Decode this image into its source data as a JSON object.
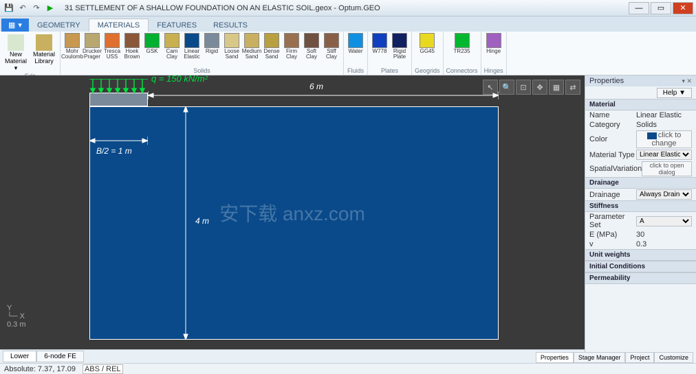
{
  "app": {
    "title": "31 SETTLEMENT OF A SHALLOW FOUNDATION ON AN ELASTIC SOIL.geox - Optum.GEO"
  },
  "tabs": {
    "file": "",
    "geometry": "GEOMETRY",
    "materials": "MATERIALS",
    "features": "FEATURES",
    "results": "RESULTS"
  },
  "ribbon": {
    "edit_group": "Edit",
    "new_material": "New\nMaterial ▾",
    "material_library": "Material\nLibrary",
    "solids_group": "Solids",
    "fluids_group": "Fluids",
    "plates_group": "Plates",
    "geogrids_group": "Geogrids",
    "connectors_group": "Connectors",
    "hinges_group": "Hinges",
    "materials": [
      {
        "name": "Mohr Coulomb",
        "label": "Mohr\nCoulomb",
        "color": "#c89850"
      },
      {
        "name": "Drucker Prager",
        "label": "Drucker\nPrager",
        "color": "#b8a870"
      },
      {
        "name": "Tresca USS",
        "label": "Tresca\nUSS",
        "color": "#e07030"
      },
      {
        "name": "Hoek Brown",
        "label": "Hoek\nBrown",
        "color": "#8a5838"
      },
      {
        "name": "GSK",
        "label": "GSK",
        "color": "#00b030"
      },
      {
        "name": "Cam Clay",
        "label": "Cam\nClay",
        "color": "#c8b050"
      },
      {
        "name": "Linear Elastic",
        "label": "Linear\nElastic",
        "color": "#0a4a8a"
      },
      {
        "name": "Rigid",
        "label": "Rigid",
        "color": "#7a8a9a"
      },
      {
        "name": "Loose Sand",
        "label": "Loose\nSand",
        "color": "#d8c888"
      },
      {
        "name": "Medium Sand",
        "label": "Medium\nSand",
        "color": "#c8b060"
      },
      {
        "name": "Dense Sand",
        "label": "Dense\nSand",
        "color": "#b8a040"
      },
      {
        "name": "Firm Clay",
        "label": "Firm\nClay",
        "color": "#987050"
      },
      {
        "name": "Soft Clay",
        "label": "Soft\nClay",
        "color": "#705040"
      },
      {
        "name": "Stiff Clay",
        "label": "Stiff\nClay",
        "color": "#886048"
      }
    ],
    "fluids": [
      {
        "name": "Water",
        "label": "Water",
        "color": "#1090e0"
      }
    ],
    "plates": [
      {
        "name": "W778",
        "label": "W778",
        "color": "#1040c0"
      },
      {
        "name": "Rigid Plate",
        "label": "Rigid\nPlate",
        "color": "#102060"
      }
    ],
    "geogrids": [
      {
        "name": "GG45",
        "label": "GG45",
        "color": "#e8d820"
      }
    ],
    "connectors": [
      {
        "name": "TR235",
        "label": "TR235",
        "color": "#00b830"
      }
    ],
    "hinges": [
      {
        "name": "Hinge",
        "label": "Hinge",
        "color": "#a060c0"
      }
    ]
  },
  "props": {
    "title": "Properties",
    "help": "Help ▼",
    "sections": {
      "material": "Material",
      "drainage": "Drainage",
      "stiffness": "Stiffness",
      "unit": "Unit weights",
      "initial": "Initial Conditions",
      "perm": "Permeability"
    },
    "name_k": "Name",
    "name_v": "Linear Elastic",
    "cat_k": "Category",
    "cat_v": "Solids",
    "color_k": "Color",
    "color_v": "click to change",
    "mtype_k": "Material Type",
    "mtype_v": "Linear Elastic",
    "spatial_k": "SpatialVariation",
    "spatial_v": "click to open dialog",
    "drainage_k": "Drainage",
    "drainage_v": "Always Drained",
    "pset_k": "Parameter Set",
    "pset_v": "A",
    "e_k": "E (MPa)",
    "e_v": "30",
    "v_k": "v",
    "v_v": "0.3"
  },
  "panel_tabs": {
    "props": "Properties",
    "stage": "Stage Manager",
    "project": "Project",
    "customize": "Customize"
  },
  "canvas_tabs": {
    "lower": "Lower",
    "sixnode": "6-node FE"
  },
  "status": {
    "abs": "Absolute: 7.37, 17.09",
    "mode": "ABS / REL"
  },
  "model": {
    "q": "q = 150 kN/m²",
    "width": "6 m",
    "height": "4 m",
    "b2": "B/2 = 1 m",
    "scale": "0.3 m",
    "axes": {
      "x": "X",
      "y": "Y"
    }
  },
  "watermark": "安下载\nanxz.com"
}
